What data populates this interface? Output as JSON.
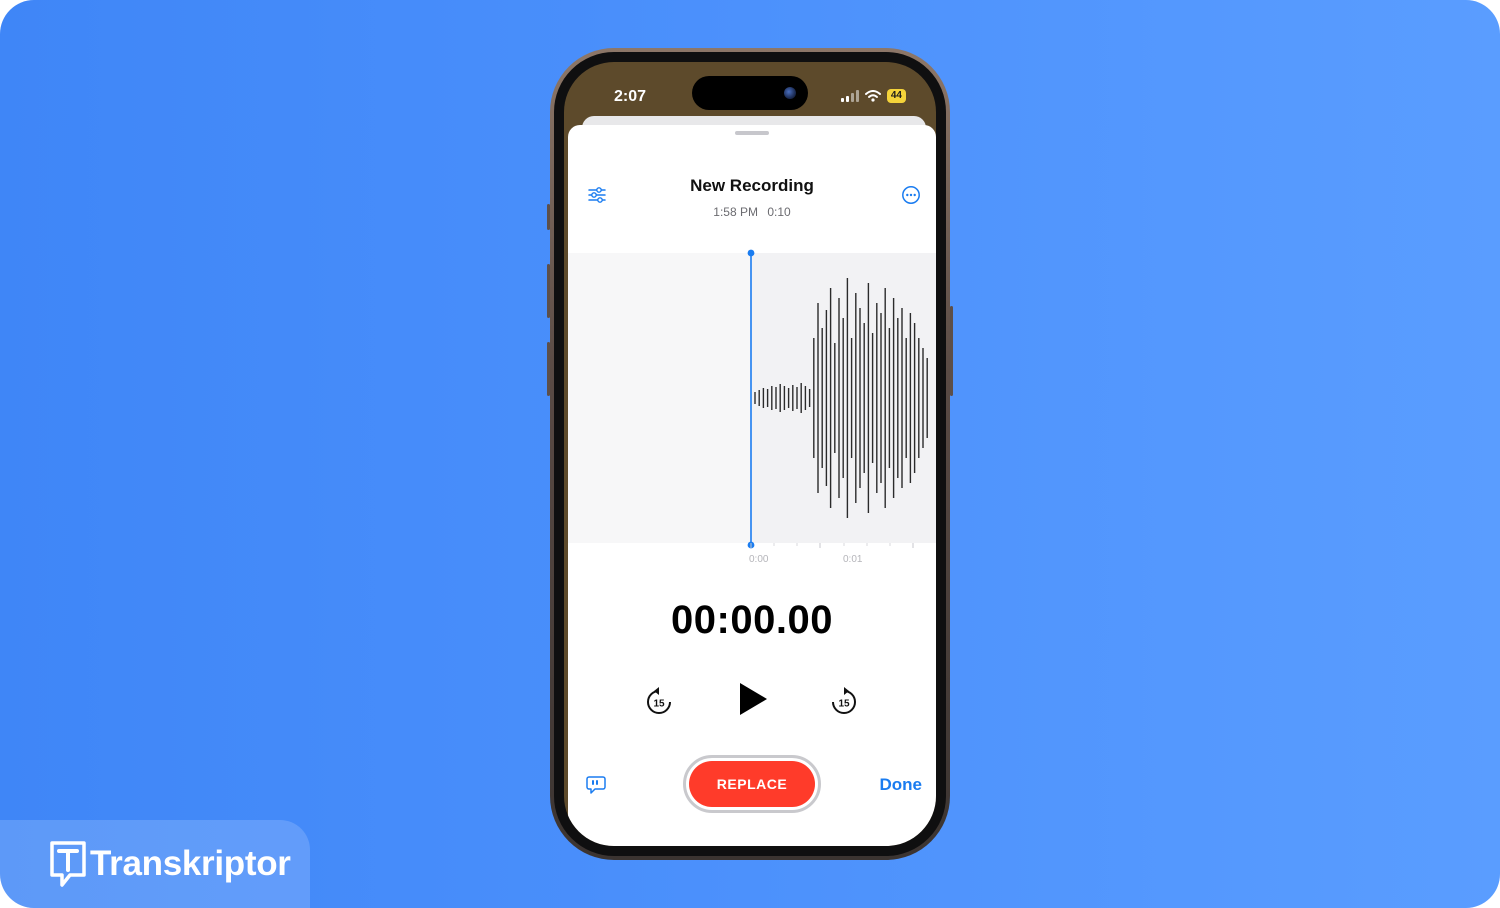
{
  "brand": {
    "name": "Transkriptor"
  },
  "status_bar": {
    "time": "2:07",
    "battery": "44"
  },
  "recording": {
    "title": "New Recording",
    "date_time": "1:58 PM",
    "duration": "0:10",
    "current_time": "00:00.00"
  },
  "timeline": {
    "labels": [
      "0:00",
      "0:01"
    ]
  },
  "controls": {
    "replace_label": "REPLACE",
    "done_label": "Done",
    "skip_back_seconds": "15",
    "skip_forward_seconds": "15"
  },
  "icons": {
    "edit": "sliders-icon",
    "more": "ellipsis-circle-icon",
    "transcript": "quote-bubble-icon",
    "play": "play-icon",
    "skip_back": "rotate-back-15-icon",
    "skip_forward": "rotate-forward-15-icon"
  },
  "colors": {
    "background": "#4c91fc",
    "accent": "#1a7cf0",
    "replace": "#ff3b2a",
    "playhead": "#1a7cf0"
  }
}
